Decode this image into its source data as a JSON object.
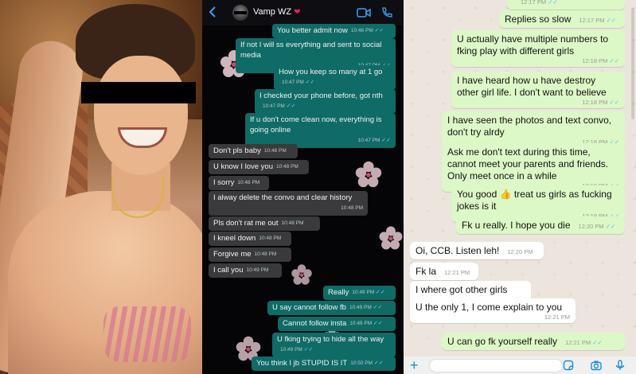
{
  "contact": {
    "name": "Vamp WZ",
    "heart": "❤"
  },
  "dark_chat": [
    {
      "text": "You better admit now",
      "time": "10:46 PM",
      "dir": "out"
    },
    {
      "text": "If not I will ss everything and sent to social media",
      "time": "10:47 PM",
      "dir": "out"
    },
    {
      "text": "How you keep so many at 1 go",
      "time": "10:47 PM",
      "dir": "out"
    },
    {
      "text": "I checked your phone before, got nth",
      "time": "10:47 PM",
      "dir": "out"
    },
    {
      "text": "If u don't come clean now, everything is going online",
      "time": "10:47 PM",
      "dir": "out"
    },
    {
      "text": "Don't pls baby",
      "time": "10:48 PM",
      "dir": "in"
    },
    {
      "text": "U know I love you",
      "time": "10:48 PM",
      "dir": "in"
    },
    {
      "text": "I sorry",
      "time": "10:48 PM",
      "dir": "in"
    },
    {
      "text": "I alway delete the convo and clear history",
      "time": "10:48 PM",
      "dir": "in"
    },
    {
      "text": "Pls don't rat me out",
      "time": "10:48 PM",
      "dir": "in"
    },
    {
      "text": "I kneel down",
      "time": "10:48 PM",
      "dir": "in"
    },
    {
      "text": "Forgive me",
      "time": "10:48 PM",
      "dir": "in"
    },
    {
      "text": "I call you",
      "time": "10:49 PM",
      "dir": "in"
    },
    {
      "text": "Really",
      "time": "10:49 PM",
      "dir": "out"
    },
    {
      "text": "U say cannot follow fb",
      "time": "10:49 PM",
      "dir": "out"
    },
    {
      "text": "Cannot follow insta",
      "time": "10:49 PM",
      "dir": "out"
    },
    {
      "text": "U fking trying to hide all the way",
      "time": "10:49 PM",
      "dir": "out"
    },
    {
      "text": "You think I jb STUPID IS IT",
      "time": "10:50 PM",
      "dir": "out"
    }
  ],
  "light_chat": [
    {
      "text": "",
      "time": "12:17 PM",
      "dir": "out"
    },
    {
      "text": "Replies so slow",
      "time": "12:17 PM",
      "dir": "out"
    },
    {
      "text": "U actually have multiple numbers to fking play with different girls",
      "time": "12:18 PM",
      "dir": "out"
    },
    {
      "text": "I have heard how u have destroy other girl life. I don't want to believe",
      "time": "12:18 PM",
      "dir": "out"
    },
    {
      "text": "I have seen the photos and text convo, don't try alrdy",
      "time": "12:18 PM",
      "dir": "out"
    },
    {
      "text": "Ask me don't text during this time, cannot meet your parents and friends. Only meet once in a while",
      "time": "12:19 PM",
      "dir": "out"
    },
    {
      "text_a": "You good",
      "emoji": "👍",
      "text_b": "treat us girls as fucking jokes is it",
      "time": "12:19 PM",
      "dir": "out"
    },
    {
      "text": "Fk u really. I hope you die",
      "time": "12:20 PM",
      "dir": "out"
    },
    {
      "text": "Oi, CCB. Listen leh!",
      "time": "12:20 PM",
      "dir": "in"
    },
    {
      "text": "Fk la",
      "time": "12:21 PM",
      "dir": "in"
    },
    {
      "text": "I where got other girls",
      "time": "12:21 PM",
      "dir": "in"
    },
    {
      "text": "U the only 1, I come explain to you",
      "time": "12:21 PM",
      "dir": "in"
    },
    {
      "text": "U can go fk yourself really",
      "time": "12:21 PM",
      "dir": "out"
    }
  ],
  "ticks": "✓✓",
  "input": {
    "plus": "+"
  },
  "icons": [
    "back-icon",
    "video-call-icon",
    "phone-icon",
    "plus-icon",
    "sticker-icon",
    "camera-icon",
    "microphone-icon"
  ],
  "colors": {
    "dark_out": "#0f6b66",
    "dark_in": "#3a3a3c",
    "light_out": "#dcf8c6",
    "light_in": "#ffffff",
    "accent": "#1a8fd8"
  }
}
